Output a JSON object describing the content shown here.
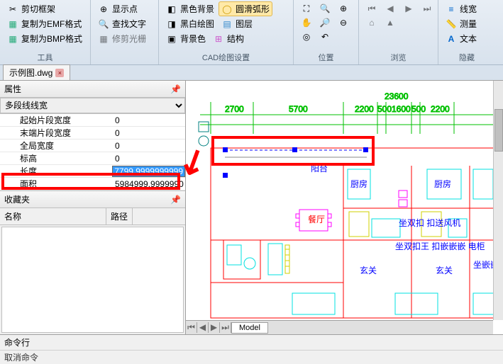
{
  "ribbon": {
    "group1": {
      "cut_frame": "剪切框架",
      "copy_emf": "复制为EMF格式",
      "copy_bmp": "复制为BMP格式",
      "label": "工具"
    },
    "group2": {
      "show_point": "显示点",
      "find_text": "查找文字",
      "repair_halo": "修剪光栅"
    },
    "group3": {
      "black_bg": "黑色背景",
      "bw_drawing": "黑白绘图",
      "bg_color": "背景色",
      "smooth_arc": "圆滑弧形",
      "layer": "图层",
      "structure": "结构",
      "label": "CAD绘图设置"
    },
    "group4": {
      "label": "位置"
    },
    "group5": {
      "label": "浏览"
    },
    "group6": {
      "linewidth": "线宽",
      "measure": "测量",
      "text": "文本",
      "label": "隐藏"
    }
  },
  "tab": {
    "name": "示例图.dwg"
  },
  "props": {
    "title": "属性",
    "type_label": "多段线线宽",
    "rows": {
      "start_seg_width": {
        "name": "起始片段宽度",
        "val": "0"
      },
      "end_seg_width": {
        "name": "末端片段宽度",
        "val": "0"
      },
      "global_width": {
        "name": "全局宽度",
        "val": "0"
      },
      "elevation": {
        "name": "标高",
        "val": "0"
      },
      "length": {
        "name": "长度",
        "val": "7799.9999999999"
      },
      "area": {
        "name": "面积",
        "val": "5984999.9999990"
      }
    }
  },
  "favorites": {
    "title": "收藏夹",
    "col_name": "名称",
    "col_path": "路径"
  },
  "drawing": {
    "dims": [
      "2700",
      "5700",
      "2200",
      "500",
      "1600",
      "500",
      "2200"
    ],
    "total_dim": "23600",
    "room_labels": {
      "balcony": "阳台",
      "kitchen1": "厨房",
      "kitchen2": "厨房",
      "dining": "餐厅",
      "note1": "坐双扣 扣送风机",
      "note2": "坐双扣王 扣嵌嵌嵌 电柜",
      "entry1": "玄关",
      "entry2": "玄关",
      "note3": "坐嵌嵌 电柜"
    },
    "model_tab": "Model"
  },
  "cmd": {
    "label": "命令行",
    "text": "取消命令"
  }
}
